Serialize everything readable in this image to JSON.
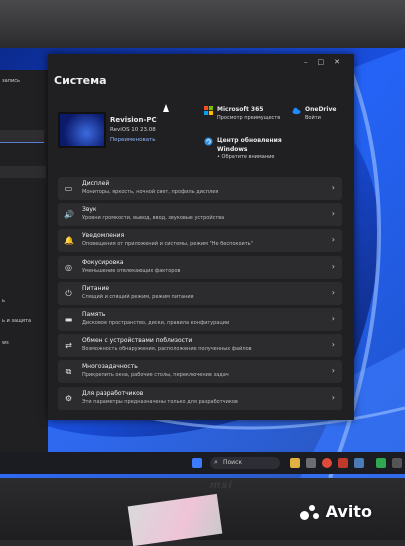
{
  "left_pane": {
    "top_text": "запись",
    "items": [
      "",
      "",
      "",
      "",
      ""
    ],
    "label_1": "ь",
    "label_2": "ь и защита",
    "label_3": "ws"
  },
  "window": {
    "title": "Система",
    "controls": [
      "–",
      "□",
      "✕"
    ]
  },
  "device": {
    "name": "Revision-PC",
    "os": "ReviOS 10 23.08",
    "rename": "Переименовать"
  },
  "quick_tiles": [
    {
      "icon": "microsoft365-icon",
      "title": "Microsoft 365",
      "sub": "Просмотр преимуществ",
      "sub2": ""
    },
    {
      "icon": "onedrive-icon",
      "title": "OneDrive",
      "sub": "Войти",
      "sub2": ""
    },
    {
      "icon": "windows-update-icon",
      "title": "Центр обновления",
      "sub": "Windows",
      "sub2": "Обратите внимание"
    }
  ],
  "settings_rows": [
    {
      "icon": "display-icon",
      "glyph": "▭",
      "title": "Дисплей",
      "sub": "Мониторы, яркость, ночной свет, профиль дисплея"
    },
    {
      "icon": "sound-icon",
      "glyph": "🔊",
      "title": "Звук",
      "sub": "Уровни громкости, вывод, ввод, звуковые устройства"
    },
    {
      "icon": "notifications-icon",
      "glyph": "🔔",
      "title": "Уведомления",
      "sub": "Оповещения от приложений и системы, режим \"Не беспокоить\""
    },
    {
      "icon": "focus-icon",
      "glyph": "◎",
      "title": "Фокусировка",
      "sub": "Уменьшение отвлекающих факторов"
    },
    {
      "icon": "power-icon",
      "glyph": "⏻",
      "title": "Питание",
      "sub": "Спящий и спящий режим, режим питания"
    },
    {
      "icon": "storage-icon",
      "glyph": "▬",
      "title": "Память",
      "sub": "Дисковое пространство, диски, правила конфигурации"
    },
    {
      "icon": "nearby-sharing-icon",
      "glyph": "⇄",
      "title": "Обмен с устройствами поблизости",
      "sub": "Возможность обнаружения, расположение полученных файлов"
    },
    {
      "icon": "multitasking-icon",
      "glyph": "⧉",
      "title": "Многозадачность",
      "sub": "Прикрепить окна, рабочие столы, переключение задач"
    },
    {
      "icon": "developers-icon",
      "glyph": "⚙",
      "title": "Для разработчиков",
      "sub": "Эти параметры предназначены только для разработчиков"
    }
  ],
  "taskbar": {
    "search_placeholder": "Поиск"
  },
  "monitor_brand": "msi",
  "watermark": "Avito"
}
